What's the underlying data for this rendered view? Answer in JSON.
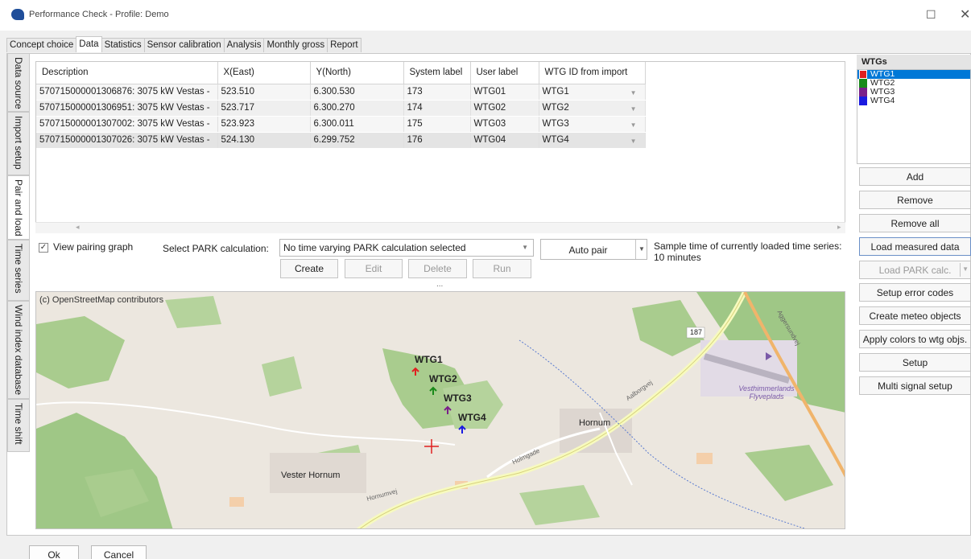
{
  "window": {
    "title": "Performance Check - Profile: Demo",
    "maximize_glyph": "☐",
    "close_glyph": "✕"
  },
  "tabs": [
    "Concept choice",
    "Data",
    "Statistics",
    "Sensor calibration",
    "Analysis",
    "Monthly gross",
    "Report"
  ],
  "active_tab": "Data",
  "side_tabs": [
    "Data source",
    "Import setup",
    "Pair and load",
    "Time series",
    "Wind index database",
    "Time shift"
  ],
  "active_side_tab": "Pair and load",
  "grid": {
    "columns": [
      "Description",
      "X(East)",
      "Y(North)",
      "System label",
      "User label",
      "WTG ID from import"
    ],
    "rows": [
      [
        "570715000001306876: 3075 kW Vestas -",
        "523.510",
        "6.300.530",
        "173",
        "WTG01",
        "WTG1"
      ],
      [
        "570715000001306951: 3075 kW Vestas -",
        "523.717",
        "6.300.270",
        "174",
        "WTG02",
        "WTG2"
      ],
      [
        "570715000001307002: 3075 kW Vestas -",
        "523.923",
        "6.300.011",
        "175",
        "WTG03",
        "WTG3"
      ],
      [
        "570715000001307026: 3075 kW Vestas -",
        "524.130",
        "6.299.752",
        "176",
        "WTG04",
        "WTG4"
      ]
    ]
  },
  "controls": {
    "view_pairing_graph": "View pairing graph",
    "view_pairing_checked": "✓",
    "select_park_label": "Select PARK calculation:",
    "park_value": "No time varying PARK calculation selected",
    "create": "Create",
    "edit": "Edit",
    "delete": "Delete",
    "run": "Run",
    "auto_pair": "Auto pair",
    "sample_time": "Sample time of currently loaded time series: 10 minutes",
    "more": "..."
  },
  "map": {
    "credit": "(c) OpenStreetMap contributors",
    "places": [
      "Vester Hornum",
      "Hornum",
      "Vesthimmerlands Flyveplads"
    ],
    "road_labels": [
      "187",
      "Hornumvej",
      "Aalborgvej",
      "Aggersundvej",
      "Holmgade"
    ],
    "turbines": [
      {
        "label": "WTG1",
        "color": "#e02020"
      },
      {
        "label": "WTG2",
        "color": "#1a8a1a"
      },
      {
        "label": "WTG3",
        "color": "#7a1f8a"
      },
      {
        "label": "WTG4",
        "color": "#1a1ae0"
      }
    ]
  },
  "wtgs": {
    "header": "WTGs",
    "items": [
      {
        "name": "WTG1",
        "color": "#e02020",
        "selected": true
      },
      {
        "name": "WTG2",
        "color": "#1a8a1a",
        "selected": false
      },
      {
        "name": "WTG3",
        "color": "#7a1f8a",
        "selected": false
      },
      {
        "name": "WTG4",
        "color": "#1a1ae0",
        "selected": false
      }
    ]
  },
  "right_buttons": {
    "add": "Add",
    "remove": "Remove",
    "remove_all": "Remove all",
    "load_measured": "Load measured data",
    "load_park": "Load PARK calc.",
    "setup_error": "Setup error codes",
    "create_meteo": "Create meteo objects",
    "apply_colors": "Apply colors to wtg objs.",
    "setup": "Setup",
    "multi_signal": "Multi signal setup"
  },
  "footer": {
    "ok": "Ok",
    "cancel": "Cancel"
  }
}
